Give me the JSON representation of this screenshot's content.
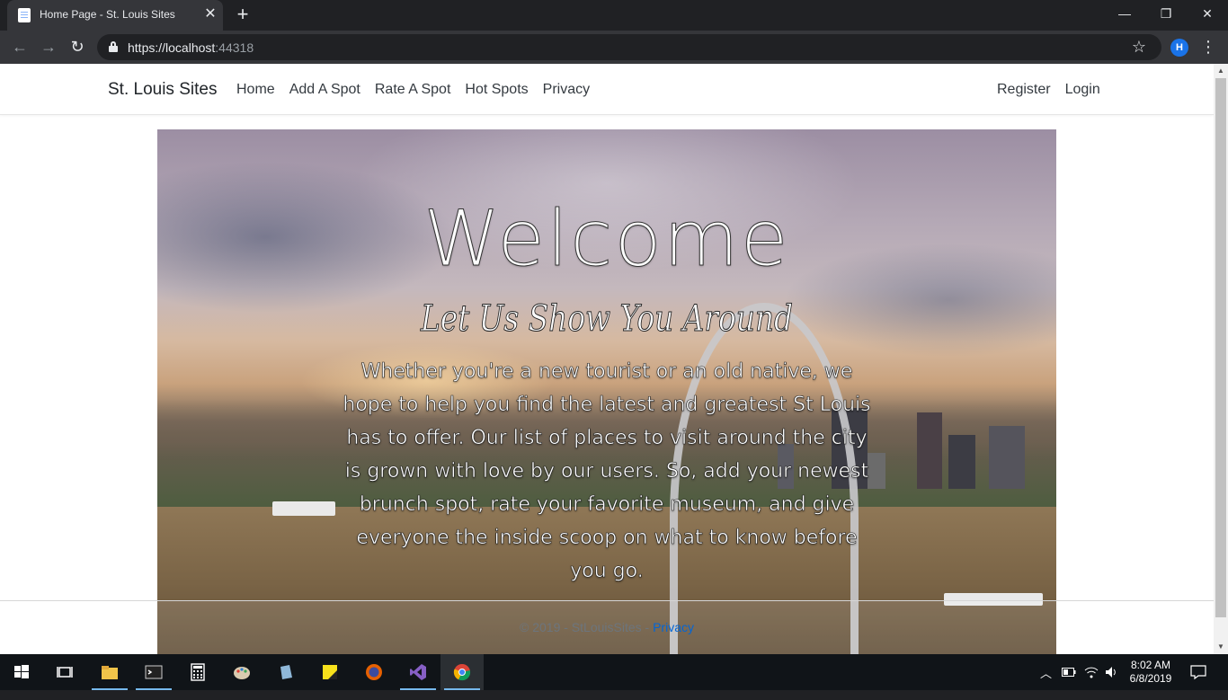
{
  "browser": {
    "tab_title": "Home Page - St. Louis Sites",
    "url_main": "https://localhost",
    "url_port": ":44318",
    "profile_initial": "H"
  },
  "site": {
    "brand": "St. Louis Sites",
    "nav": [
      "Home",
      "Add A Spot",
      "Rate A Spot",
      "Hot Spots",
      "Privacy"
    ],
    "nav_right": [
      "Register",
      "Login"
    ]
  },
  "hero": {
    "title": "Welcome",
    "subtitle": "Let Us Show You Around",
    "blurb": "Whether you're a new tourist or an old native, we hope to help you find the latest and greatest St Louis has to offer. Our list of places to visit around the city is grown with love by our users. So, add your newest brunch spot, rate your favorite museum, and give everyone the inside scoop on what to know before you go."
  },
  "footer": {
    "copyright": "© 2019 - StLouisSites - ",
    "privacy_link": "Privacy"
  },
  "taskbar": {
    "time": "8:02 AM",
    "date": "6/8/2019"
  },
  "colors": {
    "chrome_dark": "#202124",
    "chrome_toolbar": "#35363a",
    "link_blue": "#0366d6",
    "taskbar": "#101418"
  }
}
